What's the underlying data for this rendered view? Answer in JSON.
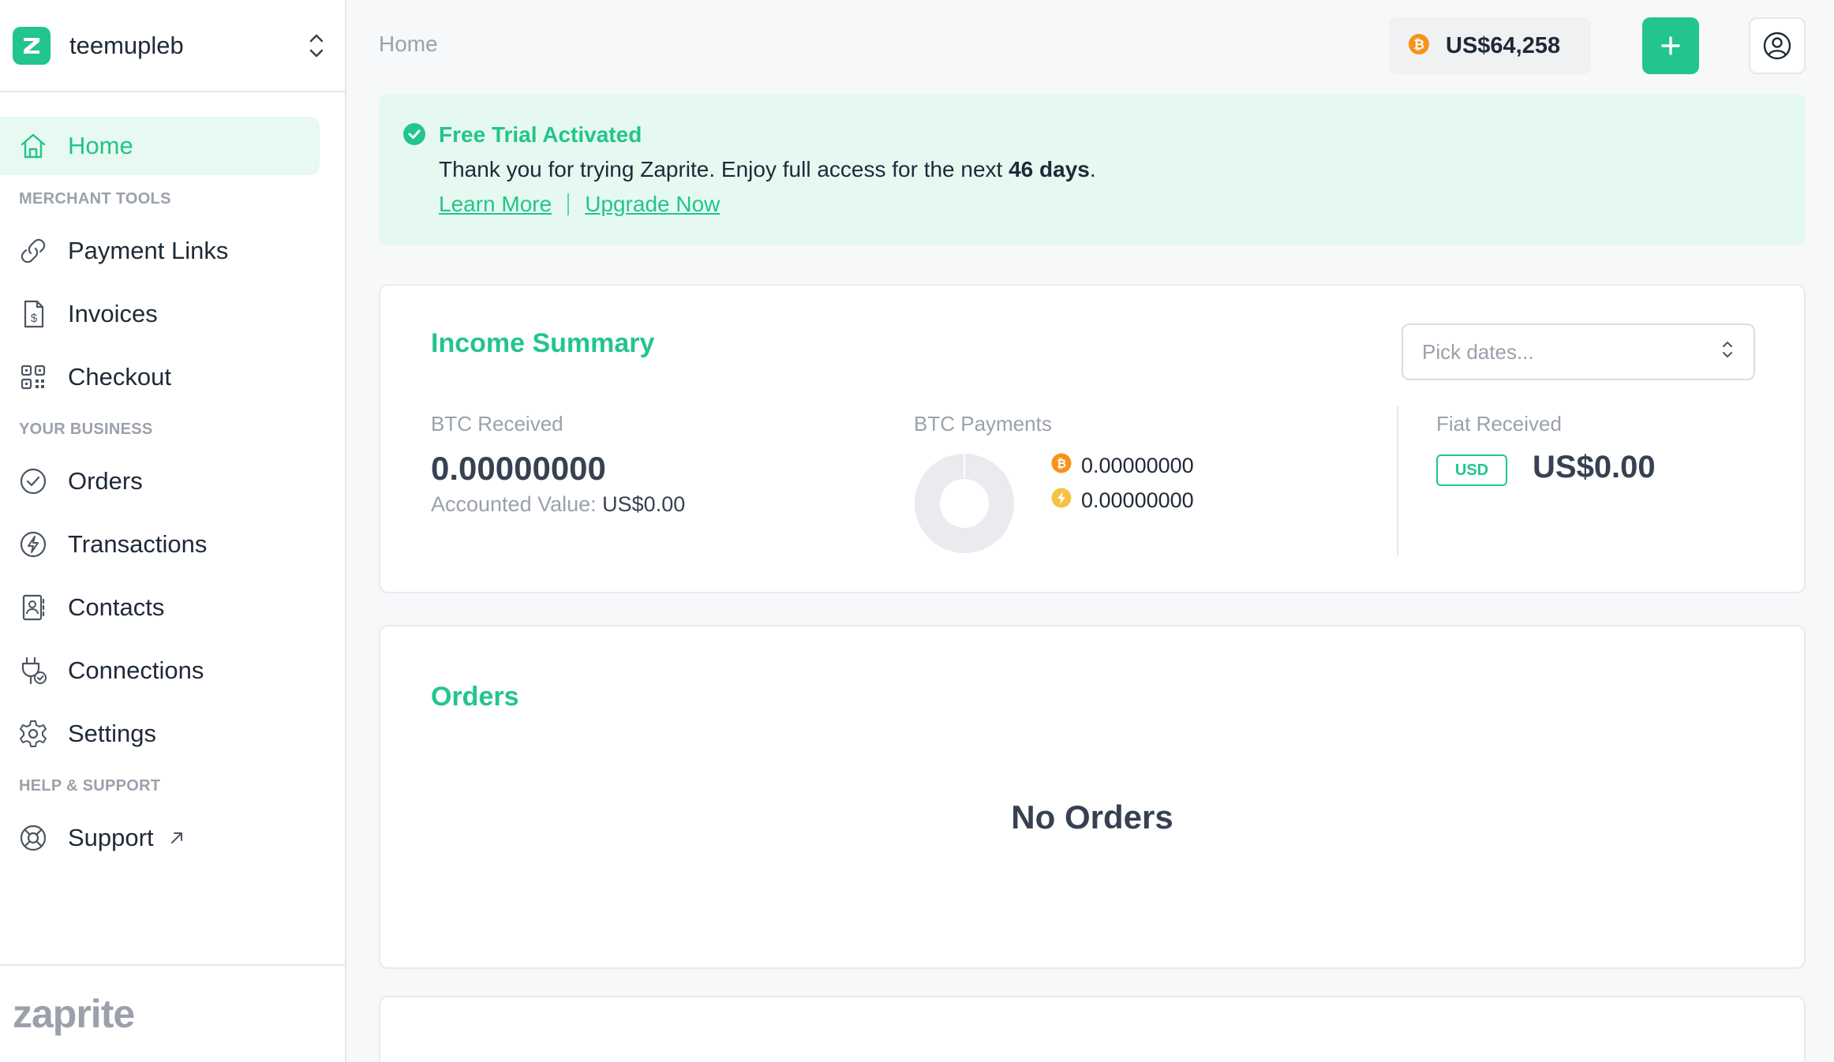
{
  "sidebar": {
    "org_name": "teemupleb",
    "sections": {
      "merchant_tools": "MERCHANT TOOLS",
      "your_business": "YOUR BUSINESS",
      "help_support": "HELP & SUPPORT"
    },
    "items": {
      "home": "Home",
      "payment_links": "Payment Links",
      "invoices": "Invoices",
      "checkout": "Checkout",
      "orders": "Orders",
      "transactions": "Transactions",
      "contacts": "Contacts",
      "connections": "Connections",
      "settings": "Settings",
      "support": "Support"
    },
    "brand": "zaprite"
  },
  "header": {
    "breadcrumb": "Home",
    "btc_price": "US$64,258"
  },
  "banner": {
    "title": "Free Trial Activated",
    "text_prefix": "Thank you for trying Zaprite. Enjoy full access for the next ",
    "days": "46 days",
    "text_suffix": ".",
    "learn_more": "Learn More",
    "upgrade_now": "Upgrade Now"
  },
  "income_summary": {
    "title": "Income Summary",
    "date_placeholder": "Pick dates...",
    "btc_received_label": "BTC Received",
    "btc_received_value": "0.00000000",
    "accounted_label": "Accounted Value: ",
    "accounted_value": "US$0.00",
    "btc_payments_label": "BTC Payments",
    "onchain_value": "0.00000000",
    "lightning_value": "0.00000000",
    "fiat_received_label": "Fiat Received",
    "fiat_currency": "USD",
    "fiat_value": "US$0.00"
  },
  "orders": {
    "title": "Orders",
    "empty": "No Orders"
  },
  "colors": {
    "accent": "#22c58b",
    "banner_bg": "#e6f9f1",
    "bitcoin": "#f7931a",
    "lightning": "#f6c343"
  }
}
